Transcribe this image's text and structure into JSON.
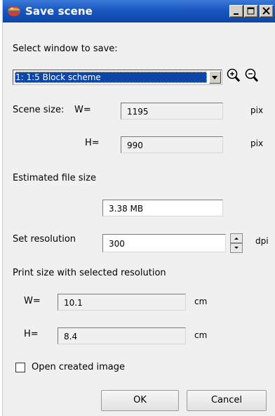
{
  "window": {
    "title": "Save scene",
    "title_icon": "app-sphere-icon",
    "controls": [
      "minimize",
      "maximize",
      "close"
    ]
  },
  "select_window": {
    "label": "Select window to save:",
    "selected": "1: 1:5 Block scheme",
    "zoom_in_icon": "zoom-in-icon",
    "zoom_out_icon": "zoom-out-icon"
  },
  "scene_size": {
    "label": "Scene size:",
    "w_label": "W=",
    "w_value": "1195",
    "h_label": "H=",
    "h_value": "990",
    "unit": "pix"
  },
  "file_size": {
    "label": "Estimated file size",
    "value": "3.38 MB"
  },
  "resolution": {
    "label": "Set resolution",
    "value": "300",
    "unit": "dpi"
  },
  "print_size": {
    "label": "Print size with selected resolution",
    "w_label": "W=",
    "w_value": "10.1",
    "h_label": "H=",
    "h_value": "8.4",
    "unit": "cm"
  },
  "open_image": {
    "label": "Open created image",
    "checked": false
  },
  "buttons": {
    "ok": "OK",
    "cancel": "Cancel"
  },
  "colors": {
    "titlebar": "#1a58c0",
    "selection": "#0c46a8",
    "dialog_bg": "#f0f0f0"
  }
}
